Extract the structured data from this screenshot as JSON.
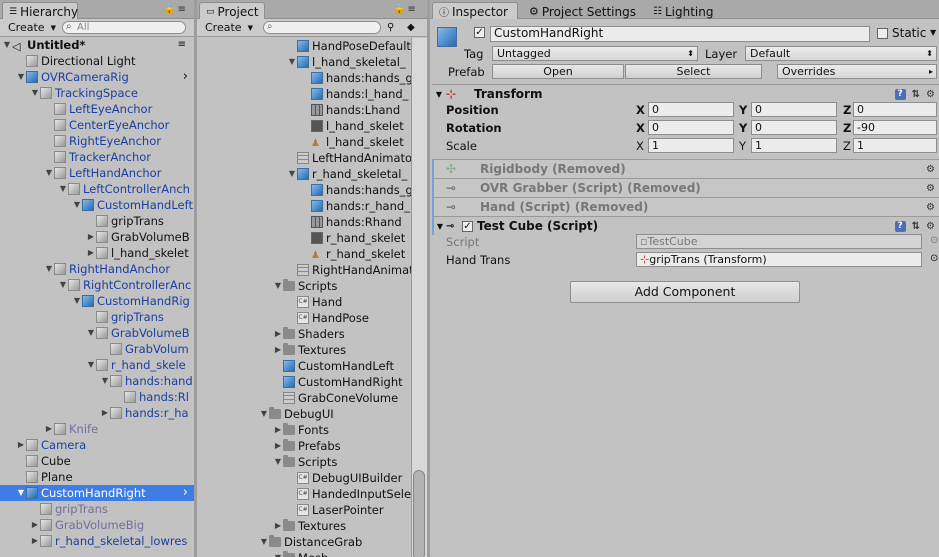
{
  "hierarchy": {
    "tab_label": "Hierarchy",
    "create_label": "Create",
    "search_placeholder": "All",
    "items": [
      {
        "label": "Untitled*",
        "indent": 0,
        "arrow": "▼",
        "icon": "scene",
        "style": "scene"
      },
      {
        "label": "Directional Light",
        "indent": 1,
        "arrow": "",
        "icon": "gcube",
        "style": ""
      },
      {
        "label": "OVRCameraRig",
        "indent": 1,
        "arrow": "▼",
        "icon": "cube",
        "style": "prefab"
      },
      {
        "label": "TrackingSpace",
        "indent": 2,
        "arrow": "▼",
        "icon": "gcube",
        "style": "prefab"
      },
      {
        "label": "LeftEyeAnchor",
        "indent": 3,
        "arrow": "",
        "icon": "gcube",
        "style": "prefab"
      },
      {
        "label": "CenterEyeAnchor",
        "indent": 3,
        "arrow": "",
        "icon": "gcube",
        "style": "prefab"
      },
      {
        "label": "RightEyeAnchor",
        "indent": 3,
        "arrow": "",
        "icon": "gcube",
        "style": "prefab"
      },
      {
        "label": "TrackerAnchor",
        "indent": 3,
        "arrow": "",
        "icon": "gcube",
        "style": "prefab"
      },
      {
        "label": "LeftHandAnchor",
        "indent": 3,
        "arrow": "▼",
        "icon": "gcube",
        "style": "prefab"
      },
      {
        "label": "LeftControllerAnch",
        "indent": 4,
        "arrow": "▼",
        "icon": "gcube",
        "style": "prefab"
      },
      {
        "label": "CustomHandLeft",
        "indent": 5,
        "arrow": "▼",
        "icon": "cube",
        "style": "prefab"
      },
      {
        "label": "gripTrans",
        "indent": 6,
        "arrow": "",
        "icon": "gcube",
        "style": ""
      },
      {
        "label": "GrabVolumeB",
        "indent": 6,
        "arrow": "▶",
        "icon": "gcube",
        "style": ""
      },
      {
        "label": "l_hand_skelet",
        "indent": 6,
        "arrow": "▶",
        "icon": "gcube",
        "style": ""
      },
      {
        "label": "RightHandAnchor",
        "indent": 3,
        "arrow": "▼",
        "icon": "gcube",
        "style": "prefab"
      },
      {
        "label": "RightControllerAnc",
        "indent": 4,
        "arrow": "▼",
        "icon": "gcube",
        "style": "prefab"
      },
      {
        "label": "CustomHandRig",
        "indent": 5,
        "arrow": "▼",
        "icon": "cube",
        "style": "prefab"
      },
      {
        "label": "gripTrans",
        "indent": 6,
        "arrow": "",
        "icon": "gcube",
        "style": "prefab"
      },
      {
        "label": "GrabVolumeB",
        "indent": 6,
        "arrow": "▼",
        "icon": "gcube",
        "style": "prefab"
      },
      {
        "label": "GrabVolum",
        "indent": 7,
        "arrow": "",
        "icon": "gcube",
        "style": "prefab"
      },
      {
        "label": "r_hand_skele",
        "indent": 6,
        "arrow": "▼",
        "icon": "gcube",
        "style": "prefab"
      },
      {
        "label": "hands:hand",
        "indent": 7,
        "arrow": "▼",
        "icon": "gcube",
        "style": "prefab"
      },
      {
        "label": "hands:Rl",
        "indent": 8,
        "arrow": "",
        "icon": "gcube",
        "style": "prefab"
      },
      {
        "label": "hands:r_ha",
        "indent": 7,
        "arrow": "▶",
        "icon": "gcube",
        "style": "prefab"
      },
      {
        "label": "Knife",
        "indent": 3,
        "arrow": "▶",
        "icon": "gcube",
        "style": "faded"
      },
      {
        "label": "Camera",
        "indent": 1,
        "arrow": "▶",
        "icon": "gcube",
        "style": "prefab"
      },
      {
        "label": "Cube",
        "indent": 1,
        "arrow": "",
        "icon": "gcube",
        "style": ""
      },
      {
        "label": "Plane",
        "indent": 1,
        "arrow": "",
        "icon": "gcube",
        "style": ""
      },
      {
        "label": "CustomHandRight",
        "indent": 1,
        "arrow": "▼",
        "icon": "cube",
        "style": "selected"
      },
      {
        "label": "gripTrans",
        "indent": 2,
        "arrow": "",
        "icon": "gcube",
        "style": "faded"
      },
      {
        "label": "GrabVolumeBig",
        "indent": 2,
        "arrow": "▶",
        "icon": "gcube",
        "style": "faded"
      },
      {
        "label": "r_hand_skeletal_lowres",
        "indent": 2,
        "arrow": "▶",
        "icon": "gcube",
        "style": "prefab"
      }
    ]
  },
  "project": {
    "tab_label": "Project",
    "create_label": "Create",
    "items": [
      {
        "label": "HandPoseDefault",
        "indent": 2,
        "arrow": "",
        "icon": "cube"
      },
      {
        "label": "l_hand_skeletal_",
        "indent": 2,
        "arrow": "▼",
        "icon": "cube"
      },
      {
        "label": "hands:hands_g",
        "indent": 3,
        "arrow": "",
        "icon": "cube"
      },
      {
        "label": "hands:l_hand_",
        "indent": 3,
        "arrow": "",
        "icon": "cube"
      },
      {
        "label": "hands:Lhand",
        "indent": 3,
        "arrow": "",
        "icon": "grid"
      },
      {
        "label": "l_hand_skelet",
        "indent": 3,
        "arrow": "",
        "icon": "anim"
      },
      {
        "label": "l_hand_skelet",
        "indent": 3,
        "arrow": "",
        "icon": "avatar"
      },
      {
        "label": "LeftHandAnimato",
        "indent": 2,
        "arrow": "",
        "icon": "mesh"
      },
      {
        "label": "r_hand_skeletal_",
        "indent": 2,
        "arrow": "▼",
        "icon": "cube"
      },
      {
        "label": "hands:hands_g",
        "indent": 3,
        "arrow": "",
        "icon": "cube"
      },
      {
        "label": "hands:r_hand_",
        "indent": 3,
        "arrow": "",
        "icon": "cube"
      },
      {
        "label": "hands:Rhand",
        "indent": 3,
        "arrow": "",
        "icon": "grid"
      },
      {
        "label": "r_hand_skelet",
        "indent": 3,
        "arrow": "",
        "icon": "anim"
      },
      {
        "label": "r_hand_skelet",
        "indent": 3,
        "arrow": "",
        "icon": "avatar"
      },
      {
        "label": "RightHandAnimat",
        "indent": 2,
        "arrow": "",
        "icon": "mesh"
      },
      {
        "label": "Scripts",
        "indent": 1,
        "arrow": "▼",
        "icon": "folder"
      },
      {
        "label": "Hand",
        "indent": 2,
        "arrow": "",
        "icon": "cs"
      },
      {
        "label": "HandPose",
        "indent": 2,
        "arrow": "",
        "icon": "cs"
      },
      {
        "label": "Shaders",
        "indent": 1,
        "arrow": "▶",
        "icon": "folder"
      },
      {
        "label": "Textures",
        "indent": 1,
        "arrow": "▶",
        "icon": "folder"
      },
      {
        "label": "CustomHandLeft",
        "indent": 1,
        "arrow": "",
        "icon": "cube"
      },
      {
        "label": "CustomHandRight",
        "indent": 1,
        "arrow": "",
        "icon": "cube"
      },
      {
        "label": "GrabConeVolume",
        "indent": 1,
        "arrow": "",
        "icon": "mesh"
      },
      {
        "label": "DebugUI",
        "indent": 0,
        "arrow": "▼",
        "icon": "folder"
      },
      {
        "label": "Fonts",
        "indent": 1,
        "arrow": "▶",
        "icon": "folder"
      },
      {
        "label": "Prefabs",
        "indent": 1,
        "arrow": "▶",
        "icon": "folder"
      },
      {
        "label": "Scripts",
        "indent": 1,
        "arrow": "▼",
        "icon": "folder"
      },
      {
        "label": "DebugUIBuilder",
        "indent": 2,
        "arrow": "",
        "icon": "cs"
      },
      {
        "label": "HandedInputSele",
        "indent": 2,
        "arrow": "",
        "icon": "cs"
      },
      {
        "label": "LaserPointer",
        "indent": 2,
        "arrow": "",
        "icon": "cs"
      },
      {
        "label": "Textures",
        "indent": 1,
        "arrow": "▶",
        "icon": "folder"
      },
      {
        "label": "DistanceGrab",
        "indent": 0,
        "arrow": "▼",
        "icon": "folder"
      },
      {
        "label": "Mesh",
        "indent": 1,
        "arrow": "▼",
        "icon": "folder"
      }
    ]
  },
  "inspector": {
    "tabs": [
      "Inspector",
      "Project Settings",
      "Lighting"
    ],
    "object_name": "CustomHandRight",
    "static_label": "Static",
    "tag_label": "Tag",
    "tag_value": "Untagged",
    "layer_label": "Layer",
    "layer_value": "Default",
    "prefab_label": "Prefab",
    "open_label": "Open",
    "select_label": "Select",
    "overrides_label": "Overrides",
    "transform": {
      "title": "Transform",
      "position_label": "Position",
      "rotation_label": "Rotation",
      "scale_label": "Scale",
      "position": [
        "0",
        "0",
        "0"
      ],
      "rotation": [
        "0",
        "0",
        "-90"
      ],
      "scale": [
        "1",
        "1",
        "1"
      ],
      "x": "X",
      "y": "Y",
      "z": "Z"
    },
    "removed": [
      {
        "title": "Rigidbody (Removed)"
      },
      {
        "title": "OVR Grabber (Script) (Removed)"
      },
      {
        "title": "Hand (Script) (Removed)"
      }
    ],
    "test_cube": {
      "title": "Test Cube (Script)",
      "script_label": "Script",
      "script_value": "TestCube",
      "hand_trans_label": "Hand Trans",
      "hand_trans_value": "gripTrans (Transform)"
    },
    "add_component_label": "Add Component"
  }
}
